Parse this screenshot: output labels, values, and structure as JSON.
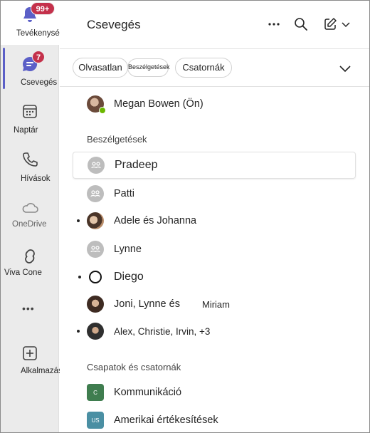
{
  "rail": {
    "activity": {
      "label": "Tevékenység",
      "badge": "99+"
    },
    "chat": {
      "label": "Csevegés",
      "badge": "7"
    },
    "calendar": {
      "label": "Naptár"
    },
    "calls": {
      "label": "Hívások"
    },
    "onedrive": {
      "label": "OneDrive"
    },
    "viva": {
      "label": "Viva Cone"
    },
    "more": {
      "label": "•••"
    },
    "apps": {
      "label": "Alkalmazások"
    }
  },
  "header": {
    "title": "Csevegés"
  },
  "filters": [
    {
      "label": "Olvasatlan"
    },
    {
      "label": "Beszélgetések"
    },
    {
      "label": "Csatornák"
    }
  ],
  "me": {
    "name": "Megan Bowen (Ön)"
  },
  "sections": {
    "conversations": "Beszélgetések",
    "teams": "Csapatok és csatornák"
  },
  "chats": [
    {
      "name": "Pradeep"
    },
    {
      "name": "Patti"
    },
    {
      "name": "Adele és Johanna"
    },
    {
      "name": "Lynne"
    },
    {
      "name": "Diego"
    },
    {
      "name": "Joni, Lynne és",
      "name_extra": "Miriam"
    },
    {
      "name": "Alex, Christie, Irvin, +3"
    }
  ],
  "teams": [
    {
      "name": "Kommunikáció",
      "initials": "C",
      "color": "#3f7d4f"
    },
    {
      "name": "Amerikai értékesítések",
      "initials": "US",
      "color": "#4a8fa3"
    }
  ],
  "colors": {
    "accent": "#5b5fc7",
    "badge": "#c4314b",
    "presence": "#6bb700"
  }
}
